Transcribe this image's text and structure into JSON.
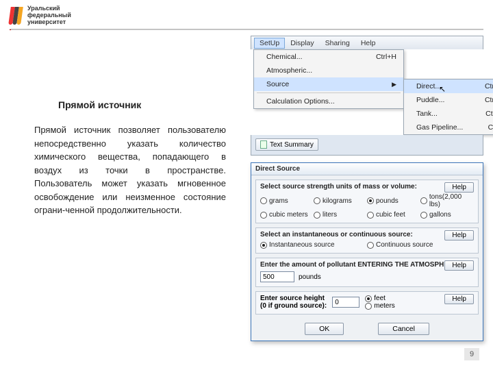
{
  "logo": {
    "line1": "Уральский",
    "line2": "федеральный",
    "line3": "университет"
  },
  "slide": {
    "title": "Прямой источник",
    "body": "Прямой источник позволяет пользователю непосредственно указать количество химического вещества, попадающего в воздух из точки в пространстве. Пользователь может указать мгновенное освобождение или неизменное состояние ограни-ченной продолжительности."
  },
  "page_number": "9",
  "menubar": {
    "items": [
      "SetUp",
      "Display",
      "Sharing",
      "Help"
    ],
    "open_index": 0
  },
  "menu": {
    "items": [
      {
        "label": "Chemical...",
        "shortcut": "Ctrl+H"
      },
      {
        "label": "Atmospheric..."
      },
      {
        "label": "Source",
        "submenu": true,
        "hover": true
      },
      {
        "sep": true
      },
      {
        "label": "Calculation Options..."
      }
    ],
    "submenu": [
      {
        "label": "Direct...",
        "shortcut": "Ctrl+D",
        "hover": true
      },
      {
        "label": "Puddle...",
        "shortcut": "Ctrl+U"
      },
      {
        "label": "Tank...",
        "shortcut": "Ctrl+T"
      },
      {
        "label": "Gas Pipeline...",
        "shortcut": "Ctrl+I"
      }
    ]
  },
  "toolbar_button": "Text Summary",
  "dialog": {
    "title": "Direct Source",
    "help": "Help",
    "group1": {
      "label": "Select source strength units of mass or volume:",
      "options": [
        "grams",
        "kilograms",
        "pounds",
        "tons(2,000 lbs)",
        "cubic meters",
        "liters",
        "cubic feet",
        "gallons"
      ],
      "selected": "pounds"
    },
    "group2": {
      "label": "Select an instantaneous or continuous source:",
      "options": [
        "Instantaneous source",
        "Continuous source"
      ],
      "selected": "Instantaneous source"
    },
    "group3": {
      "label": "Enter the amount of pollutant ENTERING THE ATMOSPHERE:",
      "value": "500",
      "unit": "pounds"
    },
    "group4": {
      "label1": "Enter source height",
      "label2": "(0 if ground source):",
      "value": "0",
      "options": [
        "feet",
        "meters"
      ],
      "selected": "feet"
    },
    "ok": "OK",
    "cancel": "Cancel"
  }
}
